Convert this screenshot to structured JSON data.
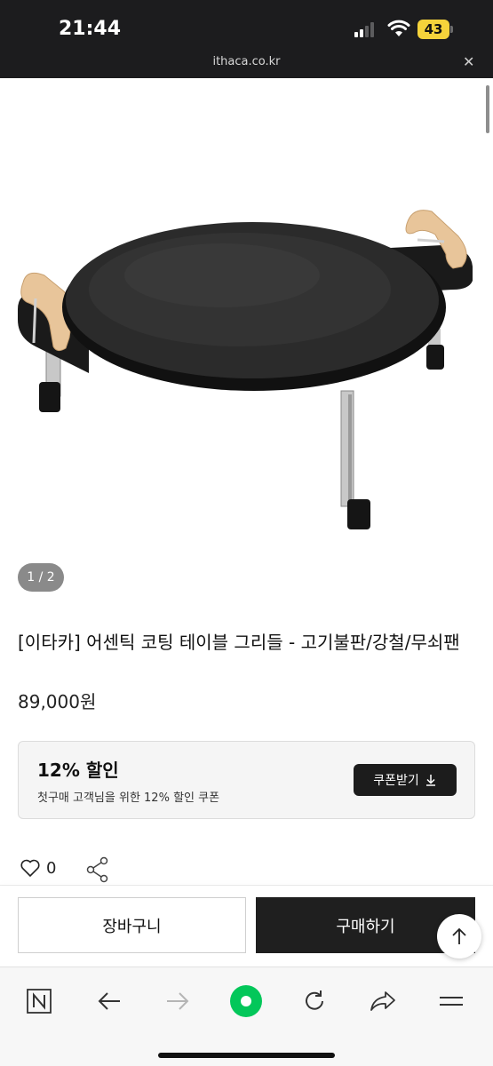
{
  "status_bar": {
    "time": "21:44",
    "battery": "43",
    "url": "ithaca.co.kr"
  },
  "product": {
    "image_page": "1 / 2",
    "title": "[이타카] 어센틱 코팅 테이블 그리들 - 고기불판/강철/무쇠팬",
    "price": "89,000원"
  },
  "coupon": {
    "title": "12% 할인",
    "description": "첫구매 고객님을 위한 12% 할인 쿠폰",
    "button_label": "쿠폰받기"
  },
  "actions": {
    "like_count": "0",
    "cart_label": "장바구니",
    "buy_label": "구매하기"
  },
  "browser_nav": {
    "items": [
      "naver-icon",
      "back-arrow-icon",
      "forward-arrow-icon",
      "green-dot-icon",
      "refresh-icon",
      "share-icon",
      "menu-icon"
    ]
  },
  "colors": {
    "accent_green": "#03c75a",
    "dark_button": "#1f1f1f",
    "battery": "#f5d33b"
  }
}
